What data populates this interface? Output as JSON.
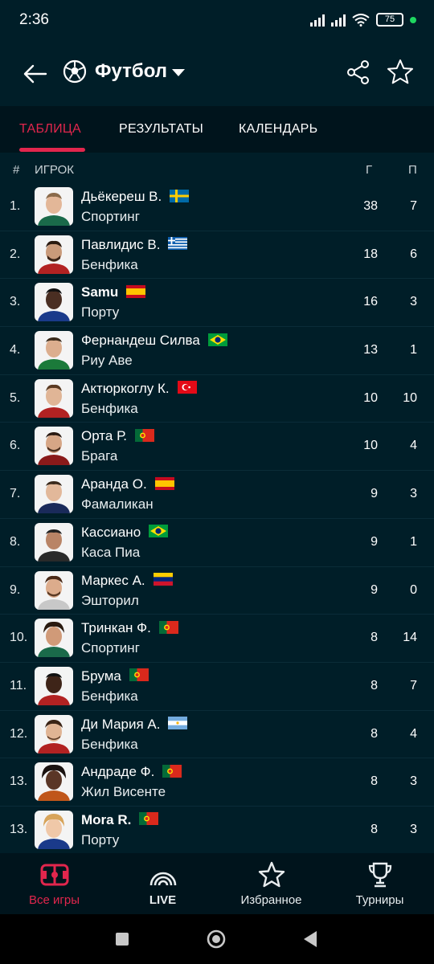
{
  "status_bar": {
    "time": "2:36",
    "battery": "75"
  },
  "app_bar": {
    "title": "Футбол"
  },
  "tabs": [
    {
      "label": "ТАБЛИЦА",
      "active": true
    },
    {
      "label": "РЕЗУЛЬТАТЫ",
      "active": false
    },
    {
      "label": "КАЛЕНДАРЬ",
      "active": false
    }
  ],
  "table": {
    "headers": {
      "rank": "#",
      "player": "ИГРОК",
      "goals": "Г",
      "assists": "П"
    },
    "rows": [
      {
        "rank": "1.",
        "name": "Дьёкереш В.",
        "team": "Спортинг",
        "flag": "sweden",
        "goals": "38",
        "assists": "7"
      },
      {
        "rank": "2.",
        "name": "Павлидис В.",
        "team": "Бенфика",
        "flag": "greece",
        "goals": "18",
        "assists": "6"
      },
      {
        "rank": "3.",
        "name": "Samu",
        "team": "Порту",
        "flag": "spain",
        "goals": "16",
        "assists": "3"
      },
      {
        "rank": "4.",
        "name": "Фернандеш Силва",
        "team": "Риу Аве",
        "flag": "brazil",
        "goals": "13",
        "assists": "1"
      },
      {
        "rank": "5.",
        "name": "Актюркоглу К.",
        "team": "Бенфика",
        "flag": "turkey",
        "goals": "10",
        "assists": "10"
      },
      {
        "rank": "6.",
        "name": "Орта Р.",
        "team": "Брага",
        "flag": "portugal",
        "goals": "10",
        "assists": "4"
      },
      {
        "rank": "7.",
        "name": "Аранда О.",
        "team": "Фамаликан",
        "flag": "spain",
        "goals": "9",
        "assists": "3"
      },
      {
        "rank": "8.",
        "name": "Кассиано",
        "team": "Каса Пиа",
        "flag": "brazil",
        "goals": "9",
        "assists": "1"
      },
      {
        "rank": "9.",
        "name": "Маркес А.",
        "team": "Эшторил",
        "flag": "venezuela",
        "goals": "9",
        "assists": "0"
      },
      {
        "rank": "10.",
        "name": "Тринкан Ф.",
        "team": "Спортинг",
        "flag": "portugal",
        "goals": "8",
        "assists": "14"
      },
      {
        "rank": "11.",
        "name": "Брума",
        "team": "Бенфика",
        "flag": "portugal",
        "goals": "8",
        "assists": "7"
      },
      {
        "rank": "12.",
        "name": "Ди Мария А.",
        "team": "Бенфика",
        "flag": "argentina",
        "goals": "8",
        "assists": "4"
      },
      {
        "rank": "13.",
        "name": "Андраде Ф.",
        "team": "Жил Висенте",
        "flag": "portugal",
        "goals": "8",
        "assists": "3"
      },
      {
        "rank": "13.",
        "name": "Mora R.",
        "team": "Порту",
        "flag": "portugal",
        "goals": "8",
        "assists": "3"
      }
    ]
  },
  "bottom_nav": [
    {
      "label": "Все игры",
      "icon": "pitch-icon",
      "active": true
    },
    {
      "label": "LIVE",
      "icon": "live-icon",
      "active": false
    },
    {
      "label": "Избранное",
      "icon": "star-icon",
      "active": false
    },
    {
      "label": "Турниры",
      "icon": "trophy-icon",
      "active": false
    }
  ],
  "colors": {
    "background": "#001e28",
    "accent": "#e2264d",
    "bar": "#00141c"
  }
}
